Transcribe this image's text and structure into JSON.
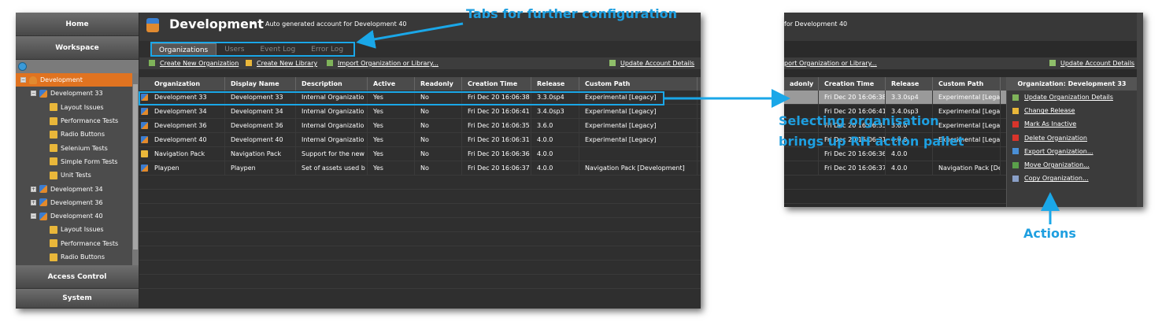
{
  "sidebar": {
    "home": "Home",
    "workspace": "Workspace",
    "access_control": "Access Control",
    "system": "System",
    "tree": [
      {
        "label": "Development",
        "level": 0,
        "expander": "−",
        "icon": "user-icon",
        "selected": true
      },
      {
        "label": "Development 33",
        "level": 1,
        "expander": "−",
        "icon": "organization-icon"
      },
      {
        "label": "Layout Issues",
        "level": 2,
        "icon": "folder-icon"
      },
      {
        "label": "Performance Tests",
        "level": 2,
        "icon": "folder-icon"
      },
      {
        "label": "Radio Buttons",
        "level": 2,
        "icon": "folder-icon"
      },
      {
        "label": "Selenium Tests",
        "level": 2,
        "icon": "folder-icon"
      },
      {
        "label": "Simple Form Tests",
        "level": 2,
        "icon": "folder-icon"
      },
      {
        "label": "Unit Tests",
        "level": 2,
        "icon": "folder-icon"
      },
      {
        "label": "Development 34",
        "level": 1,
        "expander": "+",
        "icon": "organization-icon"
      },
      {
        "label": "Development 36",
        "level": 1,
        "expander": "+",
        "icon": "organization-icon"
      },
      {
        "label": "Development 40",
        "level": 1,
        "expander": "−",
        "icon": "organization-icon"
      },
      {
        "label": "Layout Issues",
        "level": 2,
        "icon": "folder-icon"
      },
      {
        "label": "Performance Tests",
        "level": 2,
        "icon": "folder-icon"
      },
      {
        "label": "Radio Buttons",
        "level": 2,
        "icon": "folder-icon"
      }
    ]
  },
  "header": {
    "title": "Development",
    "dash": "-",
    "subtitle": "Auto generated account for Development 40"
  },
  "tabs": [
    "Organizations",
    "Users",
    "Event Log",
    "Error Log"
  ],
  "actions": {
    "create_org": "Create New Organization",
    "create_lib": "Create New Library",
    "import": "Import Organization or Library...",
    "update": "Update Account Details"
  },
  "table": {
    "columns": [
      "Organization",
      "Display Name",
      "Description",
      "Active",
      "Readonly",
      "Creation Time",
      "Release",
      "Custom Path"
    ],
    "rows": [
      [
        "Development 33",
        "Development 33",
        "Internal Organizatio",
        "Yes",
        "No",
        "Fri Dec 20 16:06:38",
        "3.3.0sp4",
        "Experimental [Legacy]"
      ],
      [
        "Development 34",
        "Development 34",
        "Internal Organizatio",
        "Yes",
        "No",
        "Fri Dec 20 16:06:41",
        "3.4.0sp3",
        "Experimental [Legacy]"
      ],
      [
        "Development 36",
        "Development 36",
        "Internal Organizatio",
        "Yes",
        "No",
        "Fri Dec 20 16:06:35",
        "3.6.0",
        "Experimental [Legacy]"
      ],
      [
        "Development 40",
        "Development 40",
        "Internal Organizatio",
        "Yes",
        "No",
        "Fri Dec 20 16:06:31",
        "4.0.0",
        "Experimental [Legacy]"
      ],
      [
        "Navigation Pack",
        "Navigation Pack",
        "Support for the new",
        "Yes",
        "No",
        "Fri Dec 20 16:06:36",
        "4.0.0",
        ""
      ],
      [
        "Playpen",
        "Playpen",
        "Set of assets used b",
        "Yes",
        "No",
        "Fri Dec 20 16:06:37",
        "4.0.0",
        "Navigation Pack [Development]"
      ]
    ]
  },
  "zoom": {
    "subtitle_fragment": "for Development 40",
    "import_fragment": "port Organization or Library...",
    "update": "Update Account Details",
    "columns": [
      "adonly",
      "Creation Time",
      "Release",
      "Custom Path"
    ],
    "rows": [
      [
        "",
        "Fri Dec 20 16:06:38",
        "3.3.0sp4",
        "Experimental [Lega"
      ],
      [
        "",
        "Fri Dec 20 16:06:41",
        "3.4.0sp3",
        "Experimental [Lega"
      ],
      [
        "",
        "Fri Dec 20 16:06:35",
        "3.6.0",
        "Experimental [Lega"
      ],
      [
        "",
        "Fri Dec 20 16:06:31",
        "4.0.0",
        "Experimental [Lega"
      ],
      [
        "",
        "Fri Dec 20 16:06:36",
        "4.0.0",
        ""
      ],
      [
        "",
        "Fri Dec 20 16:06:37",
        "4.0.0",
        "Navigation Pack [De"
      ]
    ],
    "palette_title": "Organization: Development 33",
    "palette": [
      {
        "label": "Update Organization Details",
        "icon": "edit-icon",
        "color": "#7fb35a"
      },
      {
        "label": "Change Release",
        "icon": "release-icon",
        "color": "#e9b73a"
      },
      {
        "label": "Mark As Inactive",
        "icon": "inactive-icon",
        "color": "#d9342b"
      },
      {
        "label": "Delete Organization",
        "icon": "delete-icon",
        "color": "#d9342b"
      },
      {
        "label": "Export Organization...",
        "icon": "export-icon",
        "color": "#4a8fd6"
      },
      {
        "label": "Move Organization...",
        "icon": "move-icon",
        "color": "#5aa04a"
      },
      {
        "label": "Copy Organization...",
        "icon": "copy-icon",
        "color": "#8aa0c8"
      }
    ]
  },
  "annotations": {
    "tabs": "Tabs for further configuration",
    "select_line1": "Selecting organisation",
    "select_line2": "brings up RH action pallet",
    "actions": "Actions"
  }
}
